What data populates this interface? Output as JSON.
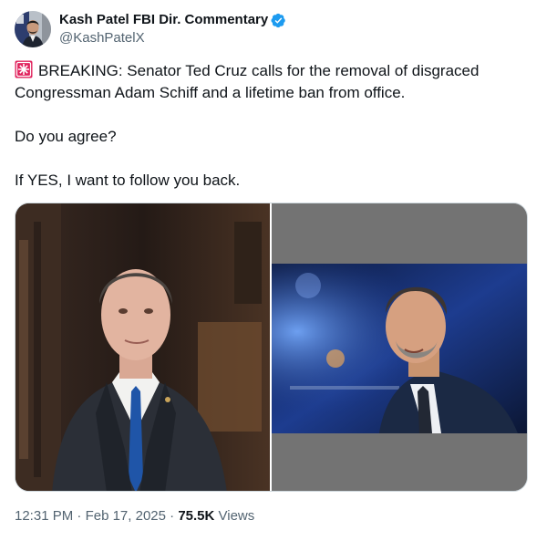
{
  "author": {
    "display_name": "Kash Patel FBI Dir. Commentary",
    "handle": "@KashPatelX",
    "verified": true,
    "verified_color": "#1d9bf0",
    "avatar_icon": "profile-photo"
  },
  "tweet": {
    "emoji": "police-car-light-icon",
    "line1": "BREAKING: Senator Ted Cruz calls for the removal of disgraced Congressman Adam Schiff and a lifetime ban from office.",
    "line2": "Do you agree?",
    "line3": "If YES, I want to follow you back."
  },
  "media": {
    "image_count": 2,
    "images": [
      {
        "subject": "Adam Schiff photo"
      },
      {
        "subject": "Ted Cruz photo"
      }
    ]
  },
  "meta": {
    "time": "12:31 PM",
    "separator": "·",
    "date": "Feb 17, 2025",
    "views_count": "75.5K",
    "views_label": "Views"
  }
}
